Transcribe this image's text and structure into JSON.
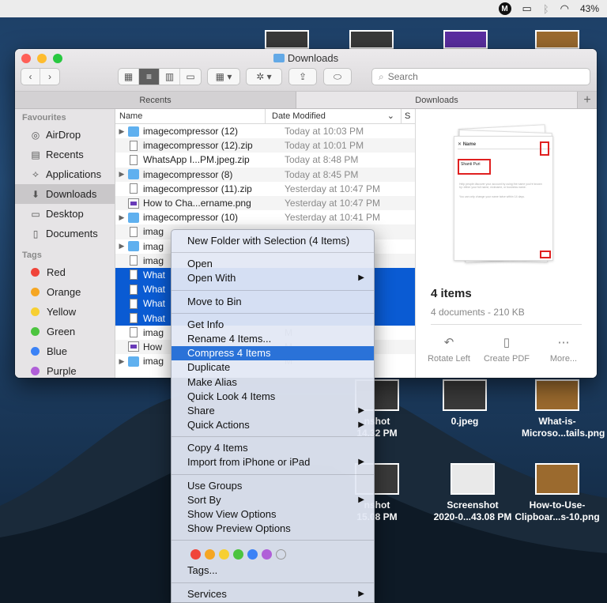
{
  "menubar": {
    "badge": "M",
    "battery": "43%",
    "icons": [
      "m-badge-icon",
      "airplay-icon",
      "bluetooth-icon",
      "wifi-icon"
    ]
  },
  "desktop": {
    "icons": [
      {
        "label": "nshot\n14.32 PM",
        "thumb": "dark"
      },
      {
        "label": "0.jpeg",
        "thumb": "dark"
      },
      {
        "label": "What-is-\nMicroso...tails.png",
        "thumb": "brown"
      },
      {
        "label": "nshot\n15.08 PM",
        "thumb": "dark"
      },
      {
        "label": "Screenshot\n2020-0...43.08 PM",
        "thumb": "light"
      },
      {
        "label": "How-to-Use-\nClipboar...s-10.png",
        "thumb": "brown"
      }
    ]
  },
  "finder": {
    "title": "Downloads",
    "search_placeholder": "Search",
    "tabs": [
      "Recents",
      "Downloads"
    ],
    "sidebar": {
      "favourites_head": "Favourites",
      "favourites": [
        {
          "label": "AirDrop",
          "icon": "airdrop-icon"
        },
        {
          "label": "Recents",
          "icon": "recents-icon"
        },
        {
          "label": "Applications",
          "icon": "applications-icon"
        },
        {
          "label": "Downloads",
          "icon": "downloads-icon",
          "selected": true
        },
        {
          "label": "Desktop",
          "icon": "desktop-icon"
        },
        {
          "label": "Documents",
          "icon": "documents-icon"
        }
      ],
      "tags_head": "Tags",
      "tags": [
        {
          "label": "Red",
          "color": "#f0443a"
        },
        {
          "label": "Orange",
          "color": "#f5a623"
        },
        {
          "label": "Yellow",
          "color": "#f7cf32"
        },
        {
          "label": "Green",
          "color": "#4cc43f"
        },
        {
          "label": "Blue",
          "color": "#3b82f6"
        },
        {
          "label": "Purple",
          "color": "#b05fd8"
        }
      ]
    },
    "columns": {
      "name": "Name",
      "date": "Date Modified",
      "size": "S"
    },
    "files": [
      {
        "type": "folder",
        "name": "imagecompressor (12)",
        "date": "Today at 10:03 PM"
      },
      {
        "type": "file",
        "name": "imagecompressor (12).zip",
        "date": "Today at 10:01 PM"
      },
      {
        "type": "file",
        "name": "WhatsApp I...PM.jpeg.zip",
        "date": "Today at 8:48 PM"
      },
      {
        "type": "folder",
        "name": "imagecompressor (8)",
        "date": "Today at 8:45 PM"
      },
      {
        "type": "file",
        "name": "imagecompressor (11).zip",
        "date": "Yesterday at 10:47 PM"
      },
      {
        "type": "img",
        "name": "How to Cha...ername.png",
        "date": "Yesterday at 10:47 PM"
      },
      {
        "type": "folder",
        "name": "imagecompressor (10)",
        "date": "Yesterday at 10:41 PM"
      },
      {
        "type": "file",
        "name": "imag",
        "date": ""
      },
      {
        "type": "folder",
        "name": "imag",
        "date": ""
      },
      {
        "type": "file",
        "name": "imag",
        "date": ""
      },
      {
        "type": "file",
        "name": "What",
        "date": "",
        "selected": true
      },
      {
        "type": "file",
        "name": "What",
        "date": "",
        "selected": true
      },
      {
        "type": "file",
        "name": "What",
        "date": "",
        "selected": true
      },
      {
        "type": "file",
        "name": "What",
        "date": "",
        "selected": true
      },
      {
        "type": "file",
        "name": "imag",
        "date": "M"
      },
      {
        "type": "img",
        "name": "How",
        "date": "M"
      },
      {
        "type": "folder",
        "name": "imag",
        "date": "M"
      }
    ],
    "preview": {
      "title": "4 items",
      "subtitle": "4 documents - 210 KB",
      "card_texts": [
        "Name",
        "Shanti Puri",
        "Help people discover your account by using the name you're known by: either your full name, nickname, or business name.",
        "You can only change your name twice within 14 days."
      ],
      "actions": [
        {
          "label": "Rotate Left",
          "icon": "rotate-left-icon"
        },
        {
          "label": "Create PDF",
          "icon": "create-pdf-icon"
        },
        {
          "label": "More...",
          "icon": "more-icon"
        }
      ]
    }
  },
  "context_menu": {
    "sections": [
      [
        {
          "label": "New Folder with Selection (4 Items)"
        }
      ],
      [
        {
          "label": "Open"
        },
        {
          "label": "Open With",
          "submenu": true
        }
      ],
      [
        {
          "label": "Move to Bin"
        }
      ],
      [
        {
          "label": "Get Info"
        },
        {
          "label": "Rename 4 Items..."
        },
        {
          "label": "Compress 4 Items",
          "highlighted": true
        },
        {
          "label": "Duplicate"
        },
        {
          "label": "Make Alias"
        },
        {
          "label": "Quick Look 4 Items"
        },
        {
          "label": "Share",
          "submenu": true
        },
        {
          "label": "Quick Actions",
          "submenu": true
        }
      ],
      [
        {
          "label": "Copy 4 Items"
        },
        {
          "label": "Import from iPhone or iPad",
          "submenu": true
        }
      ],
      [
        {
          "label": "Use Groups"
        },
        {
          "label": "Sort By",
          "submenu": true
        },
        {
          "label": "Show View Options"
        },
        {
          "label": "Show Preview Options"
        }
      ]
    ],
    "tag_colors": [
      "#f0443a",
      "#f5a623",
      "#f7cf32",
      "#4cc43f",
      "#3b82f6",
      "#b05fd8",
      ""
    ],
    "tags_label": "Tags...",
    "services_label": "Services",
    "submenu_arrow": "▶"
  }
}
